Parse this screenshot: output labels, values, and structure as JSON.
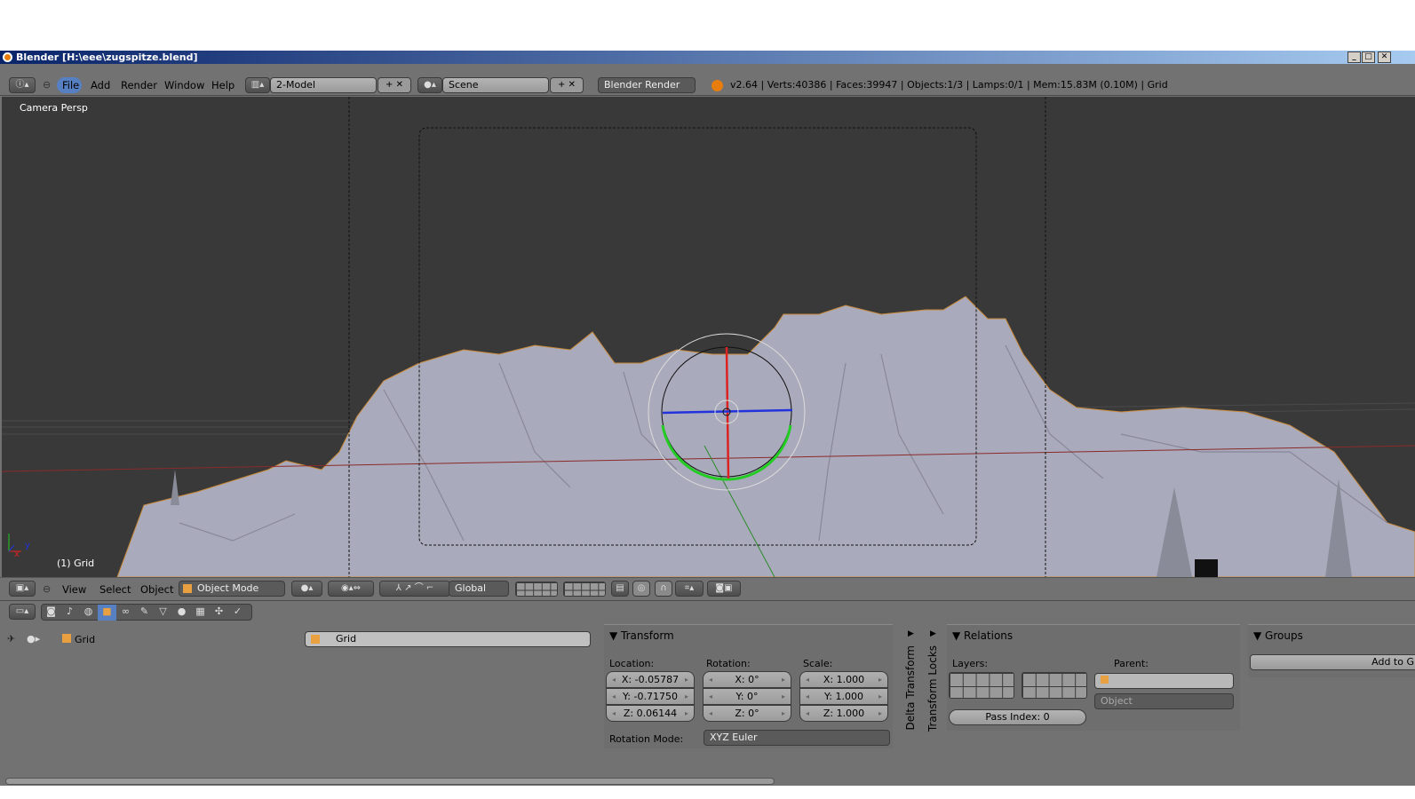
{
  "window": {
    "title": "Blender [H:\\eee\\zugspitze.blend]",
    "minimize": "_",
    "maximize": "□",
    "close": "✕"
  },
  "info_header": {
    "menus": [
      "File",
      "Add",
      "Render",
      "Window",
      "Help"
    ],
    "layout": "2-Model",
    "scene": "Scene",
    "engine": "Blender Render",
    "stats": "v2.64 | Verts:40386 | Faces:39947 | Objects:1/3 | Lamps:0/1 | Mem:15.83M (0.10M) | Grid"
  },
  "viewport": {
    "view_name": "Camera Persp",
    "object_label": "(1) Grid",
    "axis_x": "x",
    "axis_y": "y"
  },
  "view3d_header": {
    "menus": [
      "View",
      "Select",
      "Object"
    ],
    "mode": "Object Mode",
    "orientation": "Global"
  },
  "properties": {
    "context_object": "Grid",
    "object_name": "Grid",
    "transform": {
      "title": "Transform",
      "location_label": "Location:",
      "rotation_label": "Rotation:",
      "scale_label": "Scale:",
      "location": [
        "X: -0.05787",
        "Y: -0.71750",
        "Z: 0.06144"
      ],
      "rotation": [
        "X: 0°",
        "Y: 0°",
        "Z: 0°"
      ],
      "scale": [
        "X: 1.000",
        "Y: 1.000",
        "Z: 1.000"
      ],
      "rotation_mode_label": "Rotation Mode:",
      "rotation_mode": "XYZ Euler"
    },
    "delta_transform": "Delta Transform",
    "transform_locks": "Transform Locks",
    "relations": {
      "title": "Relations",
      "layers_label": "Layers:",
      "parent_label": "Parent:",
      "parent_type": "Object",
      "pass_index": "Pass Index: 0"
    },
    "groups": {
      "title": "Groups",
      "add_button": "Add to G"
    }
  }
}
